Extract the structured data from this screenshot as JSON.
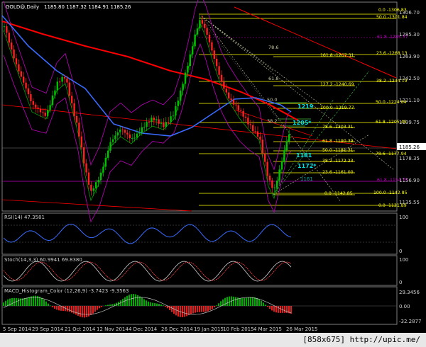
{
  "window": {
    "symbol_header": "GOLD@,Daily",
    "ohlc": "1185.80 1187.32 1184.91 1185.26"
  },
  "indicators": {
    "rsi": "RSI(14) 47.3581",
    "stoch": "Stoch(14,3,3) 60.9941 69.8380",
    "macd": "MACD_Histogram_Color (12,26,9) -3.7423 -9.3563"
  },
  "price_scale": [
    "1306.70",
    "1285.30",
    "1263.90",
    "1242.50",
    "1221.10",
    "1199.75",
    "1178.35",
    "1156.90",
    "1135.55"
  ],
  "current_price": "1185.26",
  "rsi_scale": [
    "100",
    "0"
  ],
  "stoch_scale": [
    "100",
    "0"
  ],
  "macd_scale": [
    "29.3456",
    "0.00",
    "-32.2877"
  ],
  "dates": [
    "5 Sep 2014",
    "29 Sep 2014",
    "21 Oct 2014",
    "12 Nov 2014",
    "4 Dec 2014",
    "26 Dec 2014",
    "19 Jan 2015",
    "10 Feb 2015",
    "4 Mar 2015",
    "26 Mar 2015"
  ],
  "fib_levels_right": [
    "0.0 -1306.83",
    "50.0 -1301.84",
    "61.8 -1285.37",
    "23.6 -1268.13",
    "38.2 -1244.19",
    "50.0 -1224.84",
    "61.8 -1205.49",
    "78.6 -1177.94",
    "61.8 -1154.75",
    "100.0 -1142.85",
    "0.0 -1131.89"
  ],
  "fib_levels_mid": [
    "161.8 -1267.31",
    "127.2 -1240.69",
    "100.0 -1219.77",
    "78.6 -1203.31",
    "61.8 -1190.39",
    "50.0 -1181.31",
    "38.2 -1172.23",
    "23.6 -1161.00",
    "0.0 -1142.85"
  ],
  "fan_labels": [
    "78.6",
    "61.8",
    "50.0",
    "38.2"
  ],
  "zone_labels": [
    "1219",
    "1205*",
    "1181",
    "1172*",
    "1161"
  ],
  "footer_text": "[858x675] http://upic.me/",
  "colors": {
    "bull": "#00c000",
    "bear": "#ff2020",
    "ma_red": "#ff0000",
    "ma_blue": "#3a6bff",
    "band": "#c000c0",
    "fib_yellow": "#ffff00",
    "zone_cyan": "#00e0e0"
  }
}
